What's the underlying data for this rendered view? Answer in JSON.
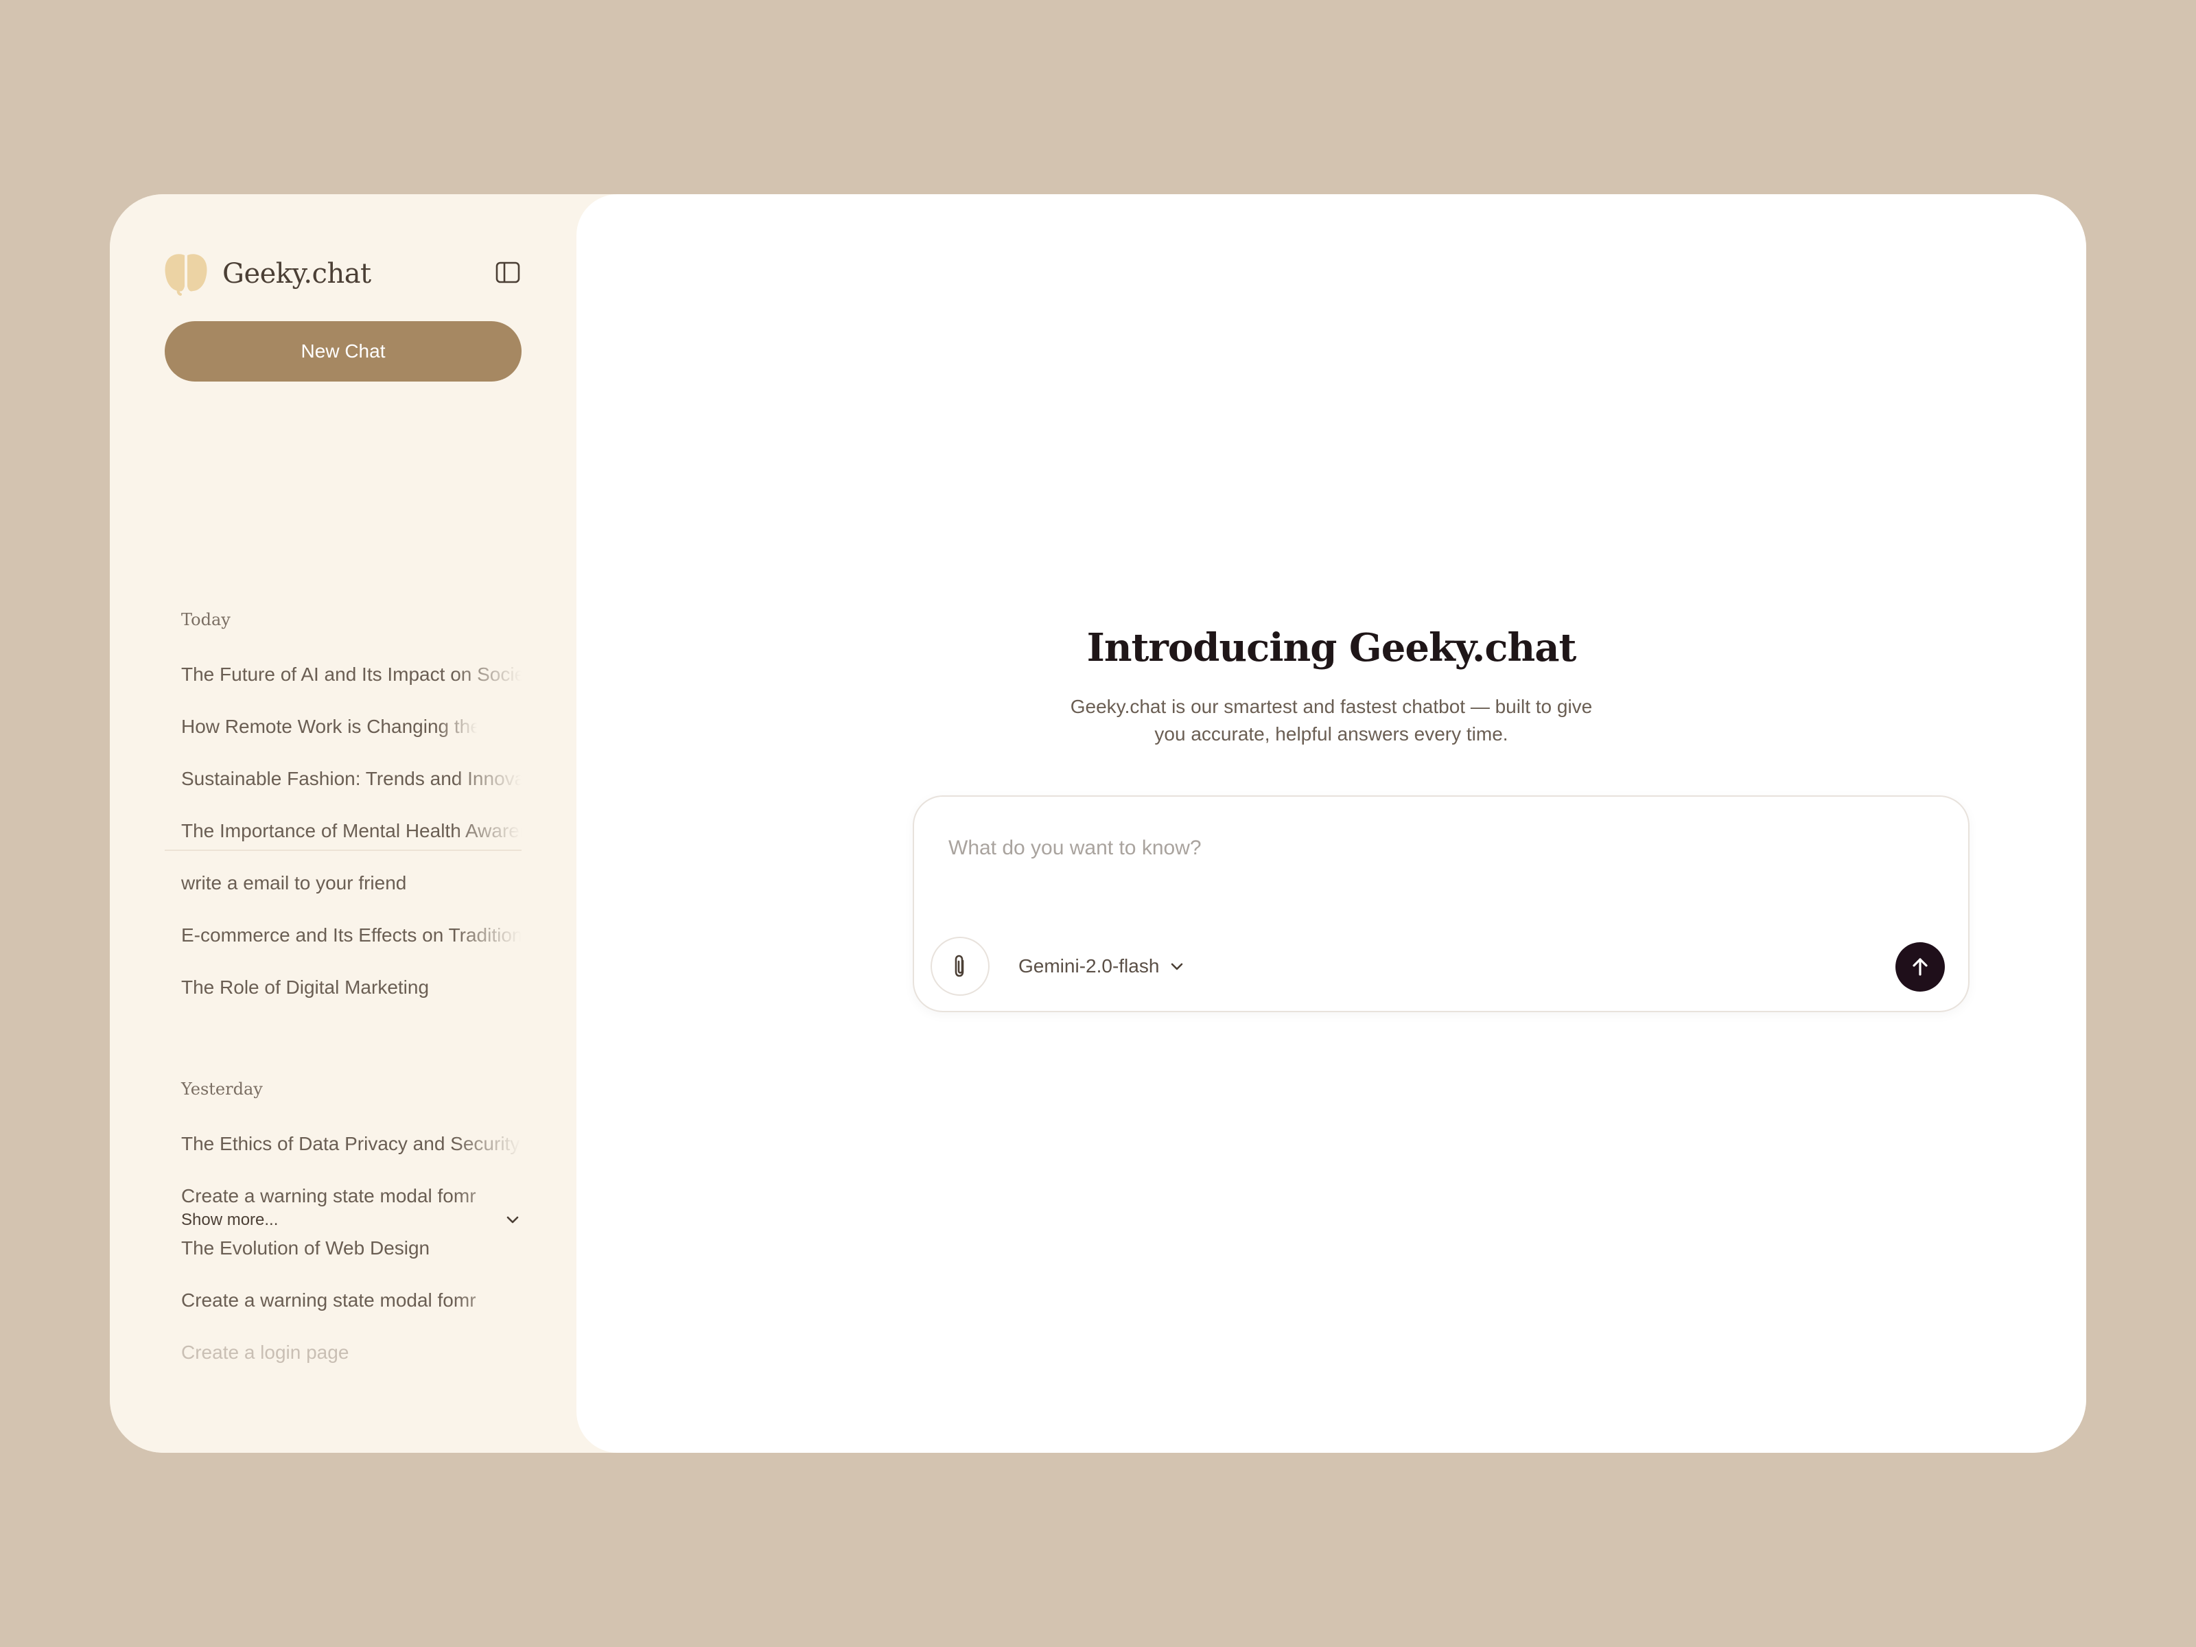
{
  "brand": {
    "name": "Geeky.chat"
  },
  "sidebar": {
    "new_chat_label": "New Chat",
    "sections": [
      {
        "label": "Today",
        "items": [
          "The Future of AI and Its Impact on Society",
          "How Remote Work is Changing the",
          "Sustainable Fashion: Trends and Innovations",
          "The Importance of Mental Health Awareness",
          "write a email to your friend",
          "E-commerce and Its Effects on Traditional",
          "The Role of Digital Marketing"
        ]
      },
      {
        "label": "Yesterday",
        "items": [
          "The Ethics of Data Privacy and Security",
          "Create a warning state modal fomr",
          "The Evolution of Web Design",
          "Create a warning state modal fomr",
          "Create a login page"
        ]
      }
    ],
    "show_more_label": "Show more..."
  },
  "main": {
    "title": "Introducing Geeky.chat",
    "subtitle": "Geeky.chat is our smartest and fastest chatbot — built to give you accurate, helpful answers every time.",
    "composer": {
      "placeholder": "What do you want to know?",
      "value": "",
      "model": "Gemini-2.0-flash"
    }
  },
  "colors": {
    "page_background": "#d3c3b0",
    "sidebar_background": "#faf4ea",
    "main_background": "#ffffff",
    "accent": "#a68862",
    "logo": "#ecd3a4",
    "send_button": "#1f0f1a",
    "text_dark": "#1f1618",
    "text_muted": "#6a5e53"
  },
  "icons": {
    "logo": "brain-icon",
    "sidebar_toggle": "sidebar-toggle-icon",
    "show_more": "chevron-down-icon",
    "attach": "paperclip-icon",
    "model": "chevron-down-icon",
    "send": "arrow-up-icon"
  }
}
